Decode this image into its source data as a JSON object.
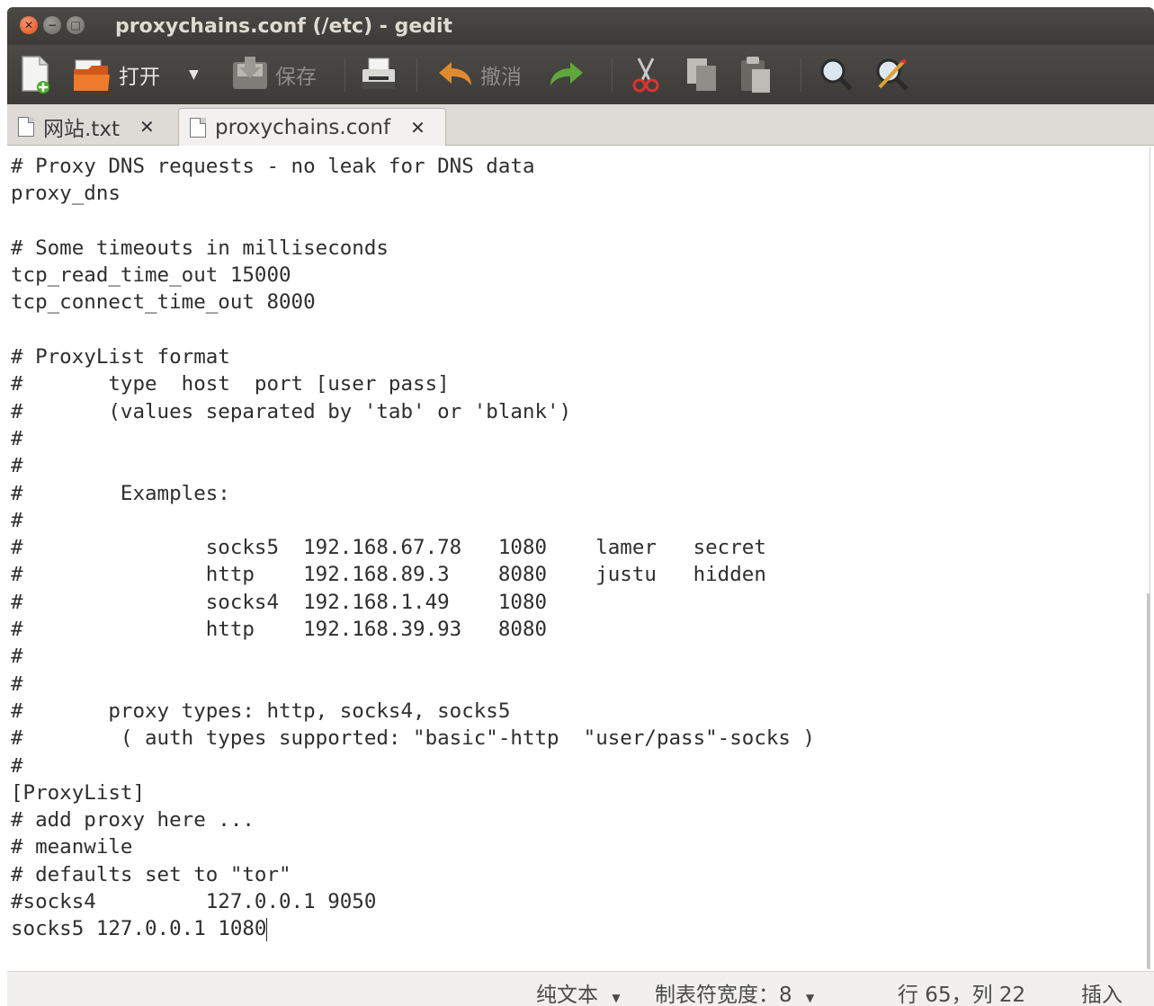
{
  "window": {
    "title": "proxychains.conf (/etc) - gedit"
  },
  "toolbar": {
    "open_label": "打开",
    "save_label": "保存",
    "undo_label": "撤消"
  },
  "tabs": [
    {
      "label": "网站.txt",
      "active": false
    },
    {
      "label": "proxychains.conf",
      "active": true
    }
  ],
  "editor": {
    "lines": [
      "# Proxy DNS requests - no leak for DNS data",
      "proxy_dns",
      "",
      "# Some timeouts in milliseconds",
      "tcp_read_time_out 15000",
      "tcp_connect_time_out 8000",
      "",
      "# ProxyList format",
      "#       type  host  port [user pass]",
      "#       (values separated by 'tab' or 'blank')",
      "#",
      "#",
      "#        Examples:",
      "#",
      "#               socks5  192.168.67.78   1080    lamer   secret",
      "#               http    192.168.89.3    8080    justu   hidden",
      "#               socks4  192.168.1.49    1080",
      "#               http    192.168.39.93   8080",
      "#",
      "#",
      "#       proxy types: http, socks4, socks5",
      "#        ( auth types supported: \"basic\"-http  \"user/pass\"-socks )",
      "#",
      "[ProxyList]",
      "# add proxy here ...",
      "# meanwile",
      "# defaults set to \"tor\"",
      "#socks4         127.0.0.1 9050",
      "socks5 127.0.0.1 1080"
    ]
  },
  "statusbar": {
    "syntax": "纯文本",
    "tab_width": "制表符宽度：8",
    "position": "行 65，列 22",
    "mode": "插入"
  }
}
